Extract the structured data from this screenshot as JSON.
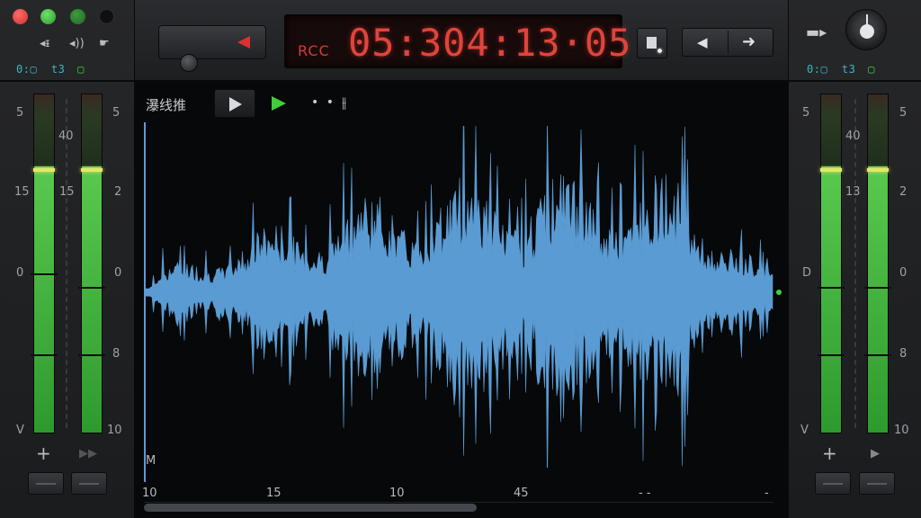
{
  "window": {
    "controls": [
      "close",
      "minimize",
      "zoom",
      "dark-mode"
    ]
  },
  "left_panel": {
    "icons": [
      "volume-low-icon",
      "volume-high-icon",
      "cursor-icon"
    ],
    "status": {
      "a": "0:",
      "b": "t3"
    },
    "scale_left": [
      "5",
      "15",
      "0",
      "V"
    ],
    "scale_mid": [
      "40",
      "2",
      "0",
      "8",
      "10"
    ],
    "meter_levels": [
      0.85,
      0.85
    ],
    "add_label": "+",
    "forward_label": "▶▶"
  },
  "transport": {
    "lcd_label": "RCC",
    "lcd_time": "05:304:13·05",
    "nav_prev": "◀",
    "nav_next": "➜"
  },
  "waveform_toolbar": {
    "label": "瀑线推",
    "dots": "• •",
    "bars": "⫲"
  },
  "waveform": {
    "color": "#5a9bd3",
    "marker": "M",
    "time_labels": [
      "10",
      "15",
      "10",
      "45",
      "- -",
      "-"
    ]
  },
  "right_panel": {
    "status": {
      "a": "0:",
      "b": "t3"
    },
    "scale_left": [
      "5",
      "40",
      "13",
      "D",
      "V"
    ],
    "scale_right": [
      "5",
      "2",
      "0",
      "8",
      "10"
    ],
    "meter_levels": [
      0.85,
      0.85
    ],
    "add_label": "+",
    "play_label": "▶"
  },
  "colors": {
    "accent_red": "#e0443b",
    "meter_green": "#4bc04a",
    "peak_yellow": "#e3e66a",
    "wave_blue": "#5a9bd3"
  }
}
